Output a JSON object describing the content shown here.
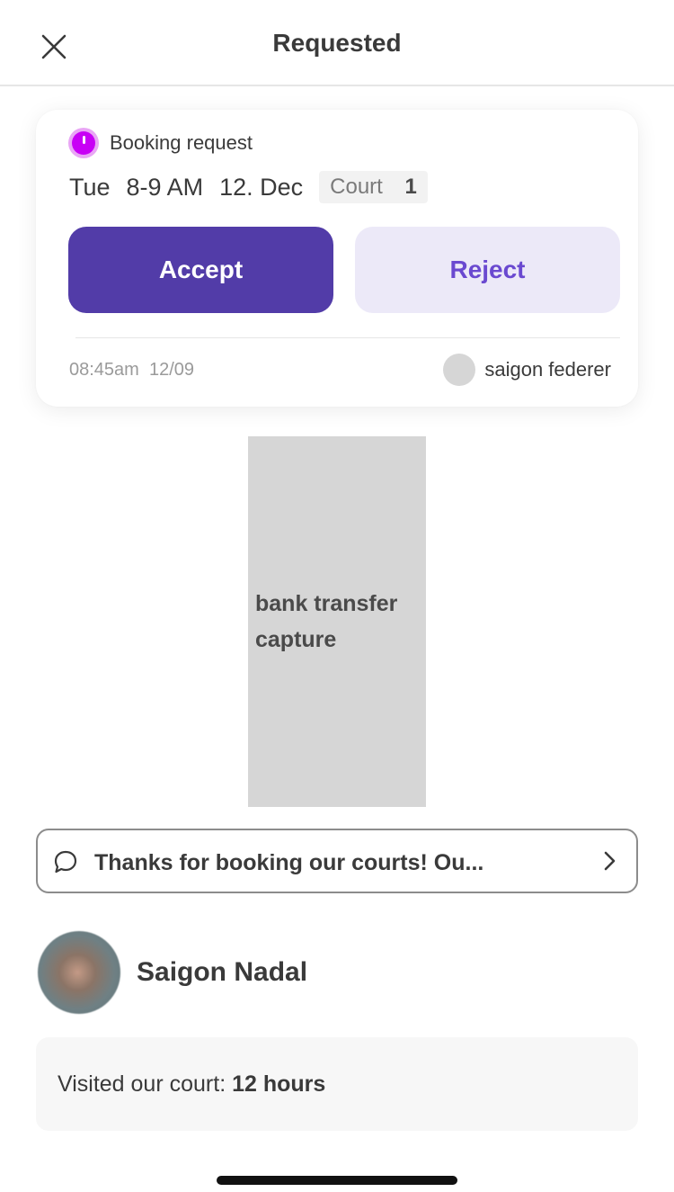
{
  "header": {
    "title": "Requested",
    "close_icon": "close-icon"
  },
  "booking": {
    "status_label": "Booking request",
    "status_color": "#c800f5",
    "day": "Tue",
    "time": "8-9 AM",
    "date": "12. Dec",
    "court_label": "Court",
    "court_number": "1",
    "accept_label": "Accept",
    "reject_label": "Reject",
    "accent_color": "#523ca8",
    "requested_time": "08:45am",
    "requested_date": "12/09",
    "requester_name": "saigon federer"
  },
  "transfer": {
    "label": "bank transfer capture"
  },
  "message": {
    "text": "Thanks for booking our courts! Ou...",
    "icon": "chat-bubble-icon"
  },
  "profile": {
    "name": "Saigon Nadal"
  },
  "visited": {
    "label": "Visited our court:",
    "value": "12 hours"
  }
}
